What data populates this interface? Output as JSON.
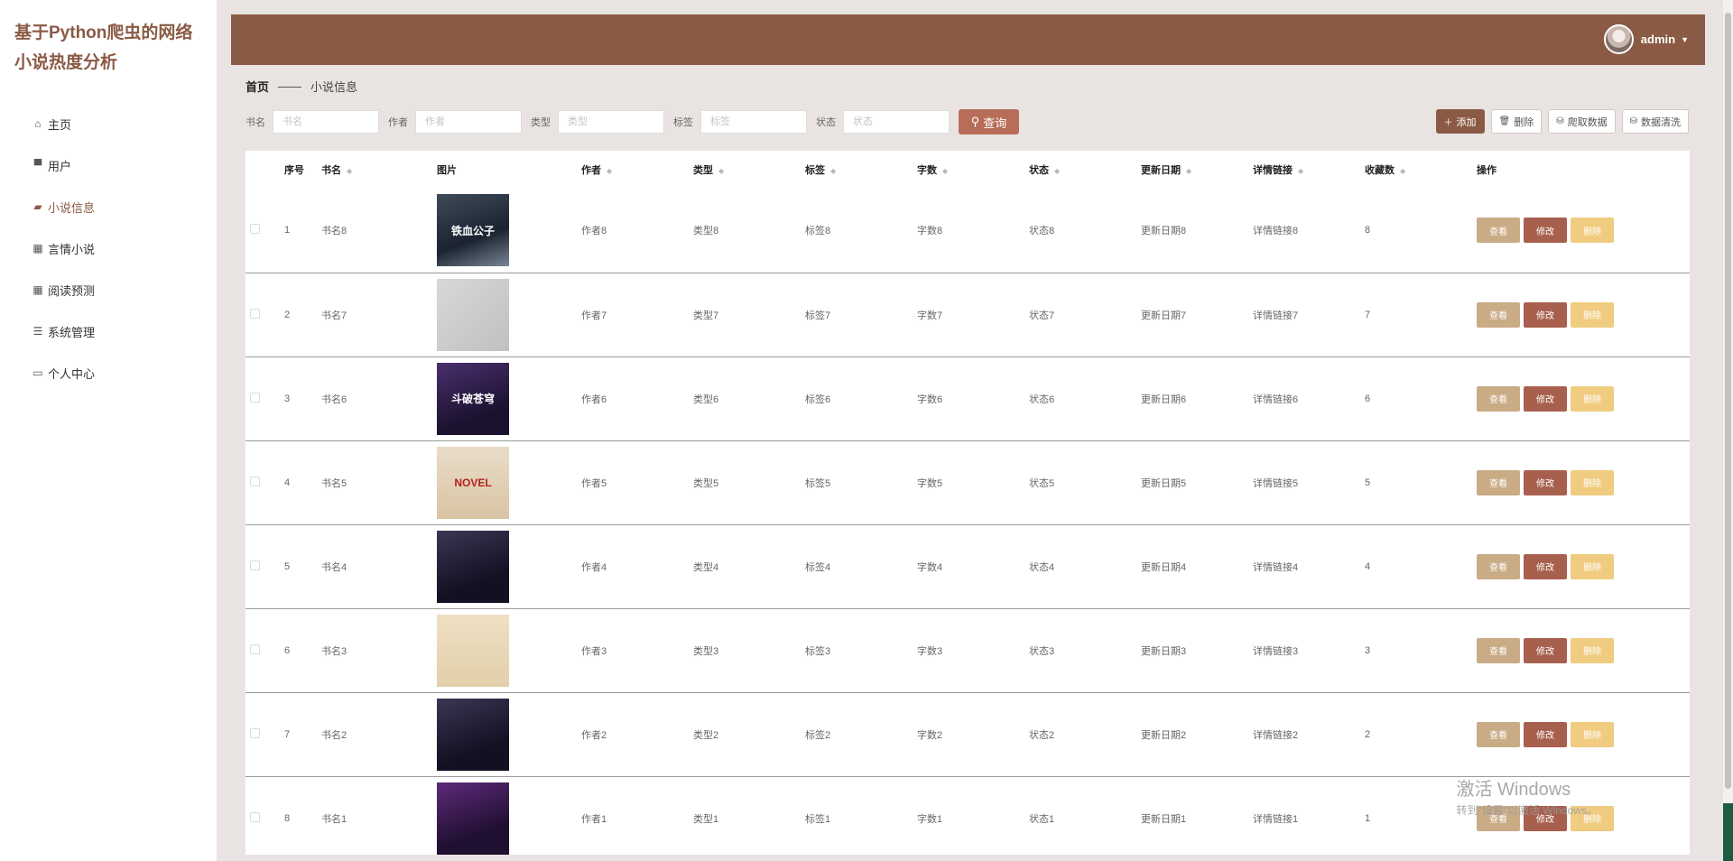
{
  "app": {
    "title": "基于Python爬虫的网络小说热度分析"
  },
  "sidebar": {
    "items": [
      {
        "label": "主页",
        "icon": "home-icon"
      },
      {
        "label": "用户",
        "icon": "monitor-icon"
      },
      {
        "label": "小说信息",
        "icon": "book-icon",
        "active": true
      },
      {
        "label": "言情小说",
        "icon": "grid-icon"
      },
      {
        "label": "阅读预测",
        "icon": "grid-icon"
      },
      {
        "label": "系统管理",
        "icon": "list-icon"
      },
      {
        "label": "个人中心",
        "icon": "card-icon"
      }
    ]
  },
  "header": {
    "username": "admin"
  },
  "breadcrumb": {
    "home": "首页",
    "separator": "——",
    "current": "小说信息"
  },
  "search": {
    "fields": [
      {
        "label": "书名",
        "placeholder": "书名"
      },
      {
        "label": "作者",
        "placeholder": "作者"
      },
      {
        "label": "类型",
        "placeholder": "类型"
      },
      {
        "label": "标签",
        "placeholder": "标签"
      },
      {
        "label": "状态",
        "placeholder": "状态"
      }
    ],
    "button": "查询"
  },
  "actions": {
    "add": "添加",
    "delete": "删除",
    "crawl": "爬取数据",
    "clean": "数据清洗"
  },
  "table": {
    "headers": [
      "序号",
      "书名",
      "图片",
      "作者",
      "类型",
      "标签",
      "字数",
      "状态",
      "更新日期",
      "详情链接",
      "收藏数",
      "操作"
    ],
    "rows": [
      {
        "index": "1",
        "name": "书名8",
        "cover_text": "铁血公子",
        "author": "作者8",
        "type": "类型8",
        "tag": "标签8",
        "words": "字数8",
        "status": "状态8",
        "date": "更新日期8",
        "link": "详情链接8",
        "fav": "8"
      },
      {
        "index": "2",
        "name": "书名7",
        "cover_text": "",
        "author": "作者7",
        "type": "类型7",
        "tag": "标签7",
        "words": "字数7",
        "status": "状态7",
        "date": "更新日期7",
        "link": "详情链接7",
        "fav": "7"
      },
      {
        "index": "3",
        "name": "书名6",
        "cover_text": "斗破苍穹",
        "author": "作者6",
        "type": "类型6",
        "tag": "标签6",
        "words": "字数6",
        "status": "状态6",
        "date": "更新日期6",
        "link": "详情链接6",
        "fav": "6"
      },
      {
        "index": "4",
        "name": "书名5",
        "cover_text": "NOVEL",
        "author": "作者5",
        "type": "类型5",
        "tag": "标签5",
        "words": "字数5",
        "status": "状态5",
        "date": "更新日期5",
        "link": "详情链接5",
        "fav": "5"
      },
      {
        "index": "5",
        "name": "书名4",
        "cover_text": "",
        "author": "作者4",
        "type": "类型4",
        "tag": "标签4",
        "words": "字数4",
        "status": "状态4",
        "date": "更新日期4",
        "link": "详情链接4",
        "fav": "4"
      },
      {
        "index": "6",
        "name": "书名3",
        "cover_text": "",
        "author": "作者3",
        "type": "类型3",
        "tag": "标签3",
        "words": "字数3",
        "status": "状态3",
        "date": "更新日期3",
        "link": "详情链接3",
        "fav": "3"
      },
      {
        "index": "7",
        "name": "书名2",
        "cover_text": "",
        "author": "作者2",
        "type": "类型2",
        "tag": "标签2",
        "words": "字数2",
        "status": "状态2",
        "date": "更新日期2",
        "link": "详情链接2",
        "fav": "2"
      },
      {
        "index": "8",
        "name": "书名1",
        "cover_text": "",
        "author": "作者1",
        "type": "类型1",
        "tag": "标签1",
        "words": "字数1",
        "status": "状态1",
        "date": "更新日期1",
        "link": "详情链接1",
        "fav": "1"
      }
    ],
    "row_actions": {
      "view": "查看",
      "edit": "修改",
      "delete": "删除"
    }
  },
  "watermark": {
    "title": "激活 Windows",
    "subtitle": "转到\"设置\"以激活 Windows。"
  },
  "colors": {
    "brand": "#8a5a44",
    "view": "#c9ab86",
    "edit": "#a8604e",
    "delete": "#f0cc80",
    "search": "#b86d58"
  }
}
